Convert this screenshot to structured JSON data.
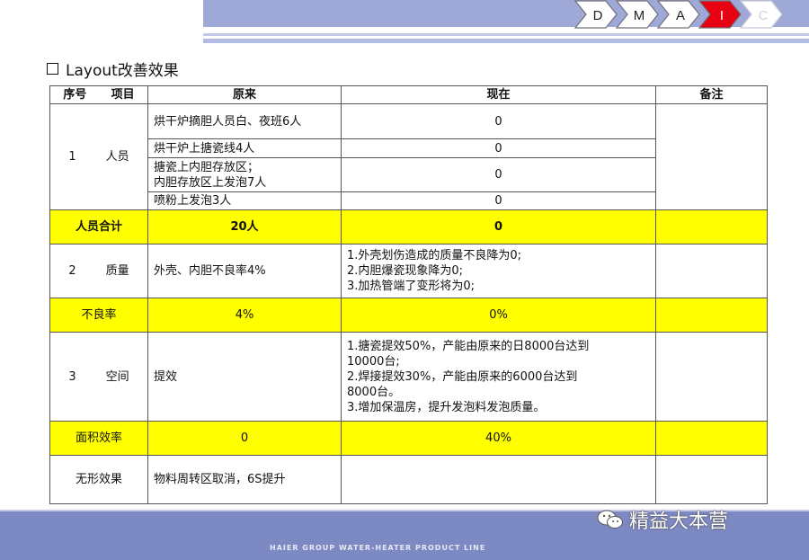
{
  "header": {
    "steps": [
      "D",
      "M",
      "A",
      "I",
      "C"
    ],
    "active_step": "I",
    "colors": {
      "band": "#9ea9d8",
      "active": "#e60012"
    }
  },
  "title": "Layout改善效果",
  "table": {
    "headers": {
      "seq": "序号",
      "item": "项目",
      "before": "原来",
      "now": "现在",
      "note": "备注"
    },
    "people": {
      "seq": "1",
      "item": "人员",
      "rows": [
        {
          "before": "烘干炉摘胆人员白、夜班6人",
          "now": "0"
        },
        {
          "before": "烘干炉上搪瓷线4人",
          "now": "0"
        },
        {
          "before_lines": [
            "搪瓷上内胆存放区；",
            "内胆存放区上发泡7人"
          ],
          "now": "0"
        },
        {
          "before": "喷粉上发泡3人",
          "now": "0"
        }
      ]
    },
    "people_total": {
      "label": "人员合计",
      "before": "20人",
      "now": "0"
    },
    "quality": {
      "seq": "2",
      "item": "质量",
      "before": "外壳、内胆不良率4%",
      "now_lines": [
        "1.外壳划伤造成的质量不良降为0;",
        "2.内胆爆瓷现象降为0;",
        "3.加热管端了变形将为0;"
      ]
    },
    "defect_rate": {
      "label": "不良率",
      "before": "4%",
      "now": "0%"
    },
    "space": {
      "seq": "3",
      "item": "空间",
      "before": "提效",
      "now_lines": [
        "1.搪瓷提效50%，产能由原来的日8000台达到",
        "10000台;",
        "2.焊接提效30%，产能由原来的6000台达到",
        "8000台。",
        "3.增加保温房，提升发泡料发泡质量。"
      ]
    },
    "area_efficiency": {
      "label": "面积效率",
      "before": "0",
      "now": "40%"
    },
    "intangible": {
      "label": "无形效果",
      "before": "物料周转区取消，6S提升",
      "now": ""
    }
  },
  "footer": {
    "text": "HAIER GROUP WATER-HEATER PRODUCT LINE"
  },
  "watermark": {
    "text": "精益大本营",
    "icon": "wechat-icon"
  }
}
